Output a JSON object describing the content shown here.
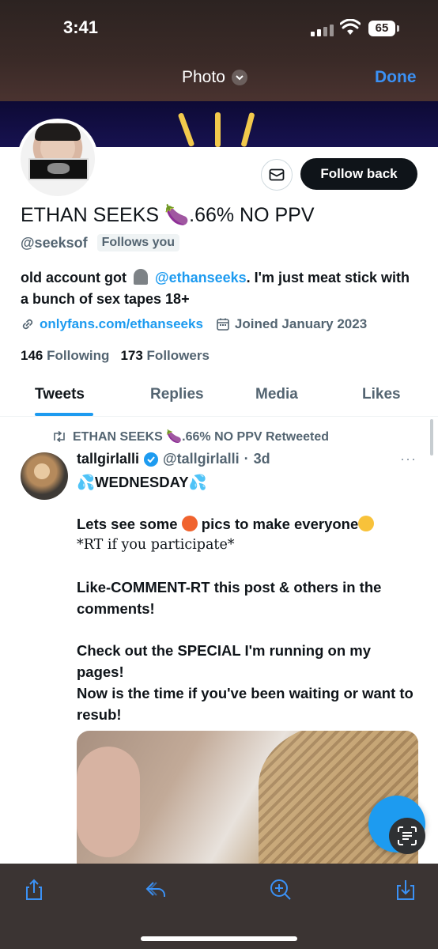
{
  "status": {
    "time": "3:41",
    "battery": "65"
  },
  "viewer": {
    "title": "Photo",
    "done": "Done"
  },
  "profile": {
    "display_name": "ETHAN SEEKS 🍆.66% NO PPV",
    "handle": "@seeksof",
    "follows_you": "Follows you",
    "follow_back": "Follow back",
    "bio_pre": "old account got",
    "bio_mention": "@ethanseeks",
    "bio_post": ". I'm just meat stick with a bunch of sex tapes 18+",
    "link": "onlyfans.com/ethanseeks",
    "joined": "Joined January 2023",
    "following_count": "146",
    "following_label": "Following",
    "followers_count": "173",
    "followers_label": "Followers"
  },
  "tabs": [
    "Tweets",
    "Replies",
    "Media",
    "Likes"
  ],
  "tweet": {
    "retweeted_by": "ETHAN SEEKS 🍆.66% NO PPV Retweeted",
    "author_name": "tallgirlalli",
    "author_handle": "@tallgirlalli",
    "dot": "·",
    "time": "3d",
    "line1": "WEDNESDAY",
    "line2_a": "Lets see some",
    "line2_b": "pics to make everyone",
    "line3": "*RT if you participate*",
    "line4": "Like-COMMENT-RT this post & others in the comments!",
    "line5": "Check out the SPECIAL I'm running on my pages!",
    "line6": "Now is the time if you've been waiting or want to resub!"
  },
  "colors": {
    "accent": "#1d9bf0",
    "text": "#0f1419",
    "muted": "#536471",
    "toolbar": "#3b3433"
  }
}
